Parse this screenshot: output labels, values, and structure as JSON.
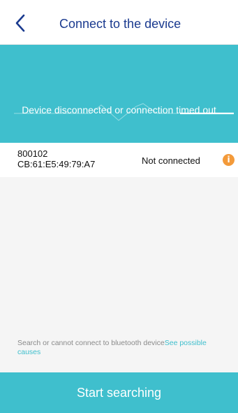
{
  "header": {
    "title": "Connect to the device",
    "back_icon": "chevron-left-icon"
  },
  "status_panel": {
    "message": "Device disconnected or connection timed out",
    "background_color": "#3fbfcd"
  },
  "devices": [
    {
      "name": "800102",
      "mac": "CB:61:E5:49:79:A7",
      "status": "Not connected",
      "status_icon": "info-icon",
      "status_icon_color": "#f39a3a"
    }
  ],
  "hint": {
    "text": "Search or cannot connect to bluetooth device",
    "link_text": "See possible causes",
    "link_color": "#3fbfcd"
  },
  "footer": {
    "button_label": "Start searching"
  },
  "colors": {
    "accent": "#3fbfcd",
    "title": "#1a3a8f",
    "warning": "#f39a3a"
  }
}
